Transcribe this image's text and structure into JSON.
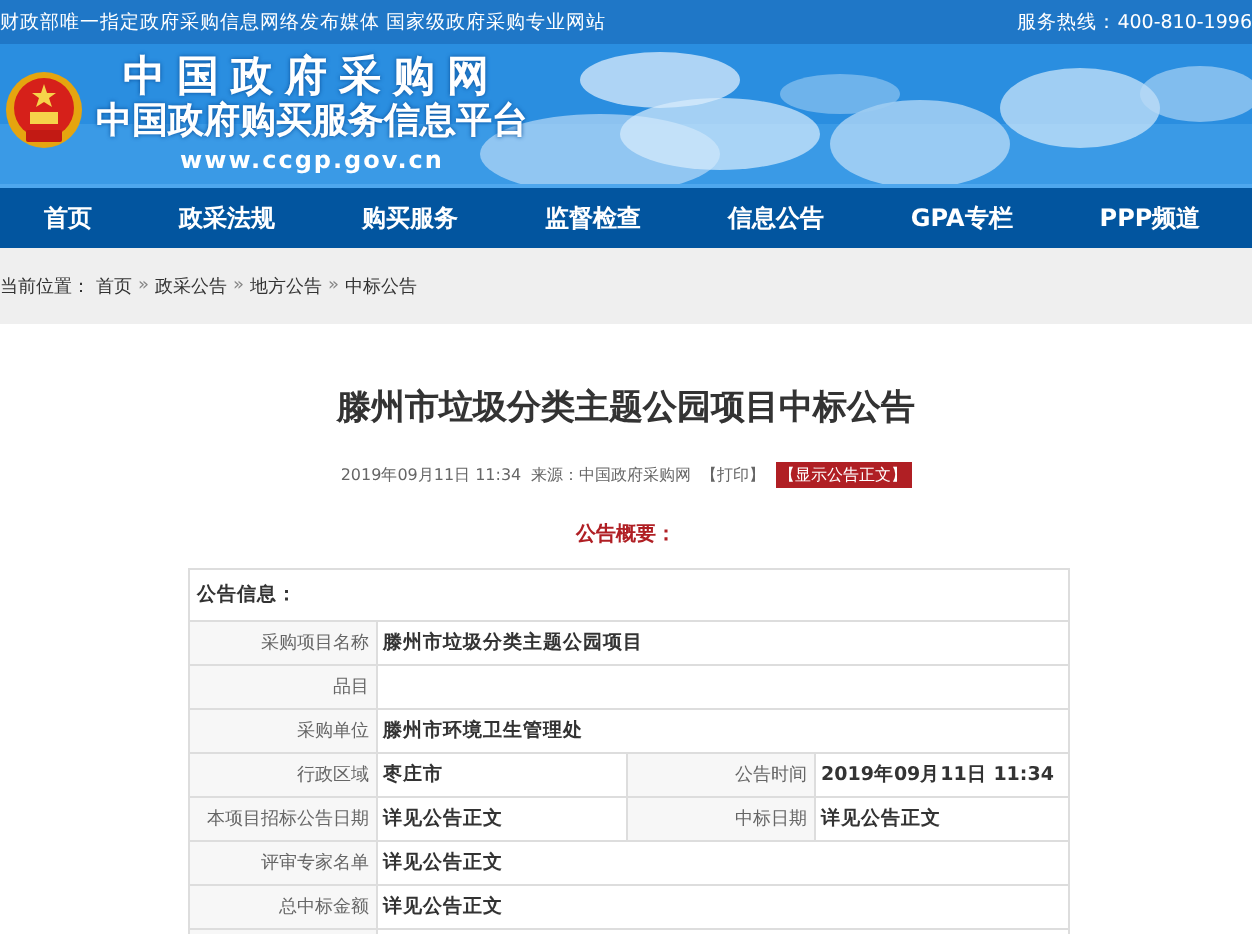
{
  "top_bar": {
    "slogan": "财政部唯一指定政府采购信息网络发布媒体 国家级政府采购专业网站",
    "hotline": "服务热线：400-810-1996"
  },
  "logo": {
    "title": "中国政府采购网",
    "subtitle": "中国政府购买服务信息平台",
    "url": "www.ccgp.gov.cn"
  },
  "nav": [
    "首页",
    "政采法规",
    "购买服务",
    "监督检查",
    "信息公告",
    "GPA专栏",
    "PPP频道"
  ],
  "breadcrumb": {
    "label": "当前位置：",
    "items": [
      "首页",
      "政采公告",
      "地方公告",
      "中标公告"
    ],
    "separator": "»"
  },
  "article": {
    "title": "滕州市垃圾分类主题公园项目中标公告",
    "date": "2019年09月11日 11:34",
    "source": "来源：中国政府采购网",
    "print": "【打印】",
    "show_body": "【显示公告正文】",
    "summary_heading": "公告概要："
  },
  "table": {
    "rows": [
      {
        "kind": "header",
        "text": "公告信息："
      },
      {
        "kind": "single",
        "label": "采购项目名称",
        "value": "滕州市垃圾分类主题公园项目"
      },
      {
        "kind": "single",
        "label": "品目",
        "value": ""
      },
      {
        "kind": "single",
        "label": "采购单位",
        "value": "滕州市环境卫生管理处"
      },
      {
        "kind": "double",
        "label": "行政区域",
        "value": "枣庄市",
        "label2": "公告时间",
        "value2": "2019年09月11日 11:34"
      },
      {
        "kind": "double",
        "label": "本项目招标公告日期",
        "value": "详见公告正文",
        "label2": "中标日期",
        "value2": "详见公告正文"
      },
      {
        "kind": "single",
        "label": "评审专家名单",
        "value": "详见公告正文"
      },
      {
        "kind": "single",
        "label": "总中标金额",
        "value": "详见公告正文"
      },
      {
        "kind": "single",
        "label": "",
        "value": ""
      }
    ]
  }
}
